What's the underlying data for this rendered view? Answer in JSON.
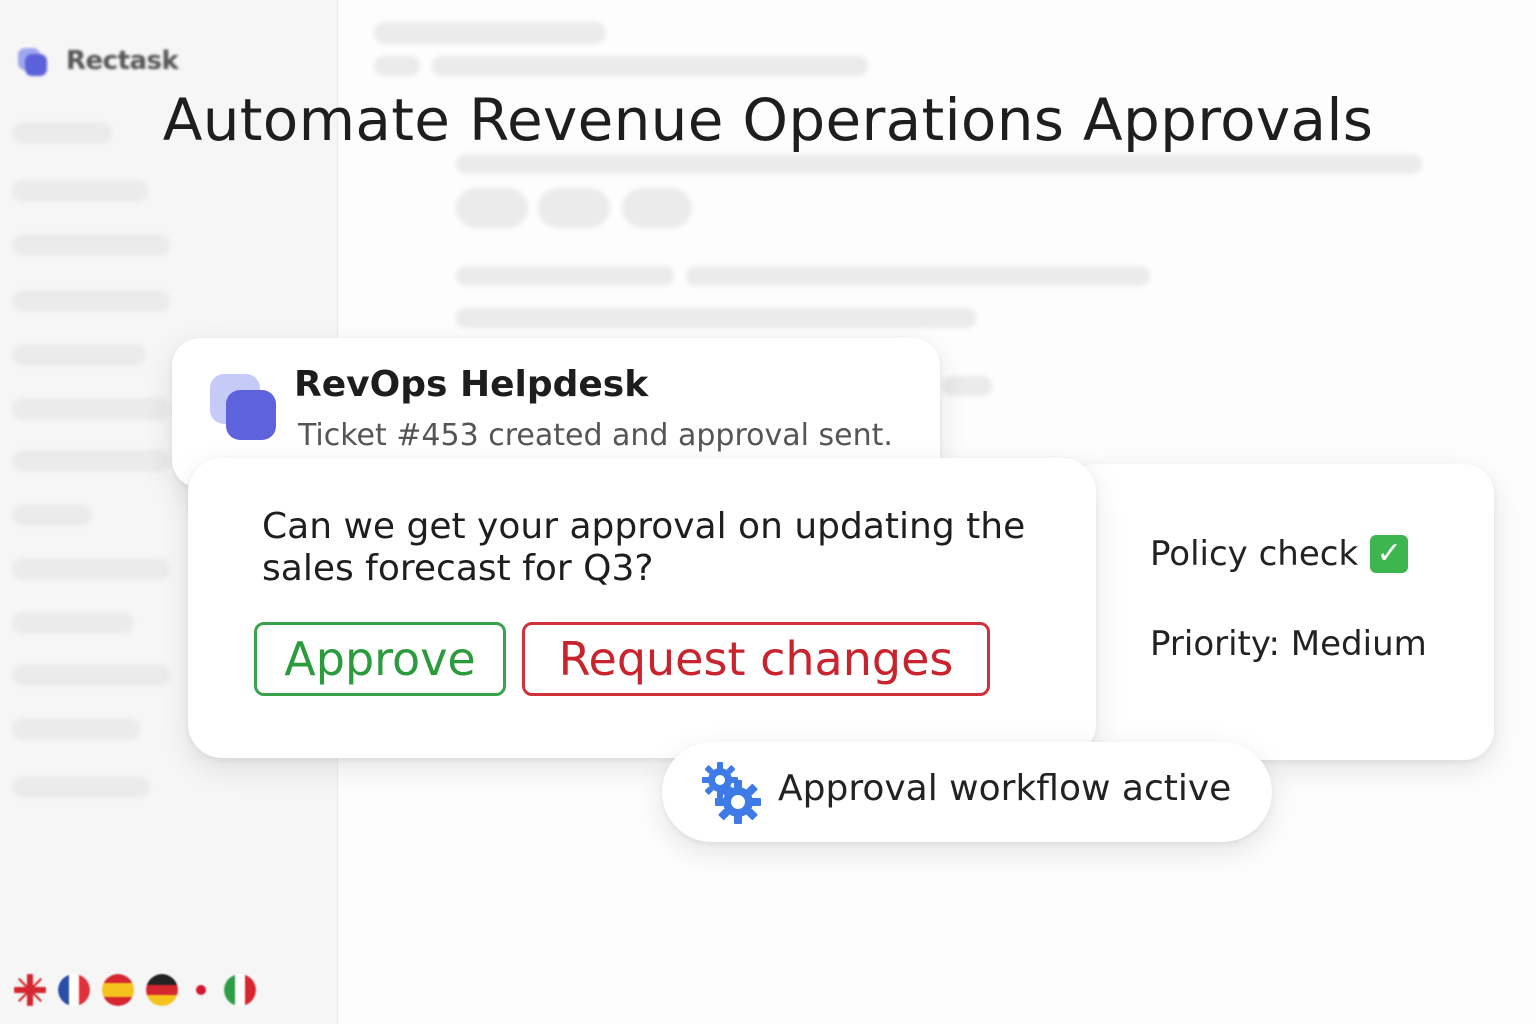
{
  "app": {
    "name": "Rectask"
  },
  "headline": "Automate Revenue Operations Approvals",
  "helpdesk": {
    "title": "RevOps Helpdesk",
    "subtitle": "Ticket #453 created and approval sent.",
    "icon": "helpdesk-logo"
  },
  "approval": {
    "question": "Can we get your approval on updating the sales forecast for Q3?",
    "approve_label": "Approve",
    "request_label": "Request changes",
    "colors": {
      "approve": "#2b9c3d",
      "request": "#c9232d"
    }
  },
  "status": {
    "policy": "Policy check",
    "policy_icon": "check-mark-icon",
    "priority": "Priority: Medium"
  },
  "workflow": {
    "label": "Approval workflow active",
    "icon": "gears-icon",
    "accent": "#3f7be6"
  },
  "languages": [
    "uk-flag-icon",
    "fr-flag-icon",
    "es-flag-icon",
    "de-flag-icon",
    "jp-flag-icon",
    "it-flag-icon"
  ]
}
